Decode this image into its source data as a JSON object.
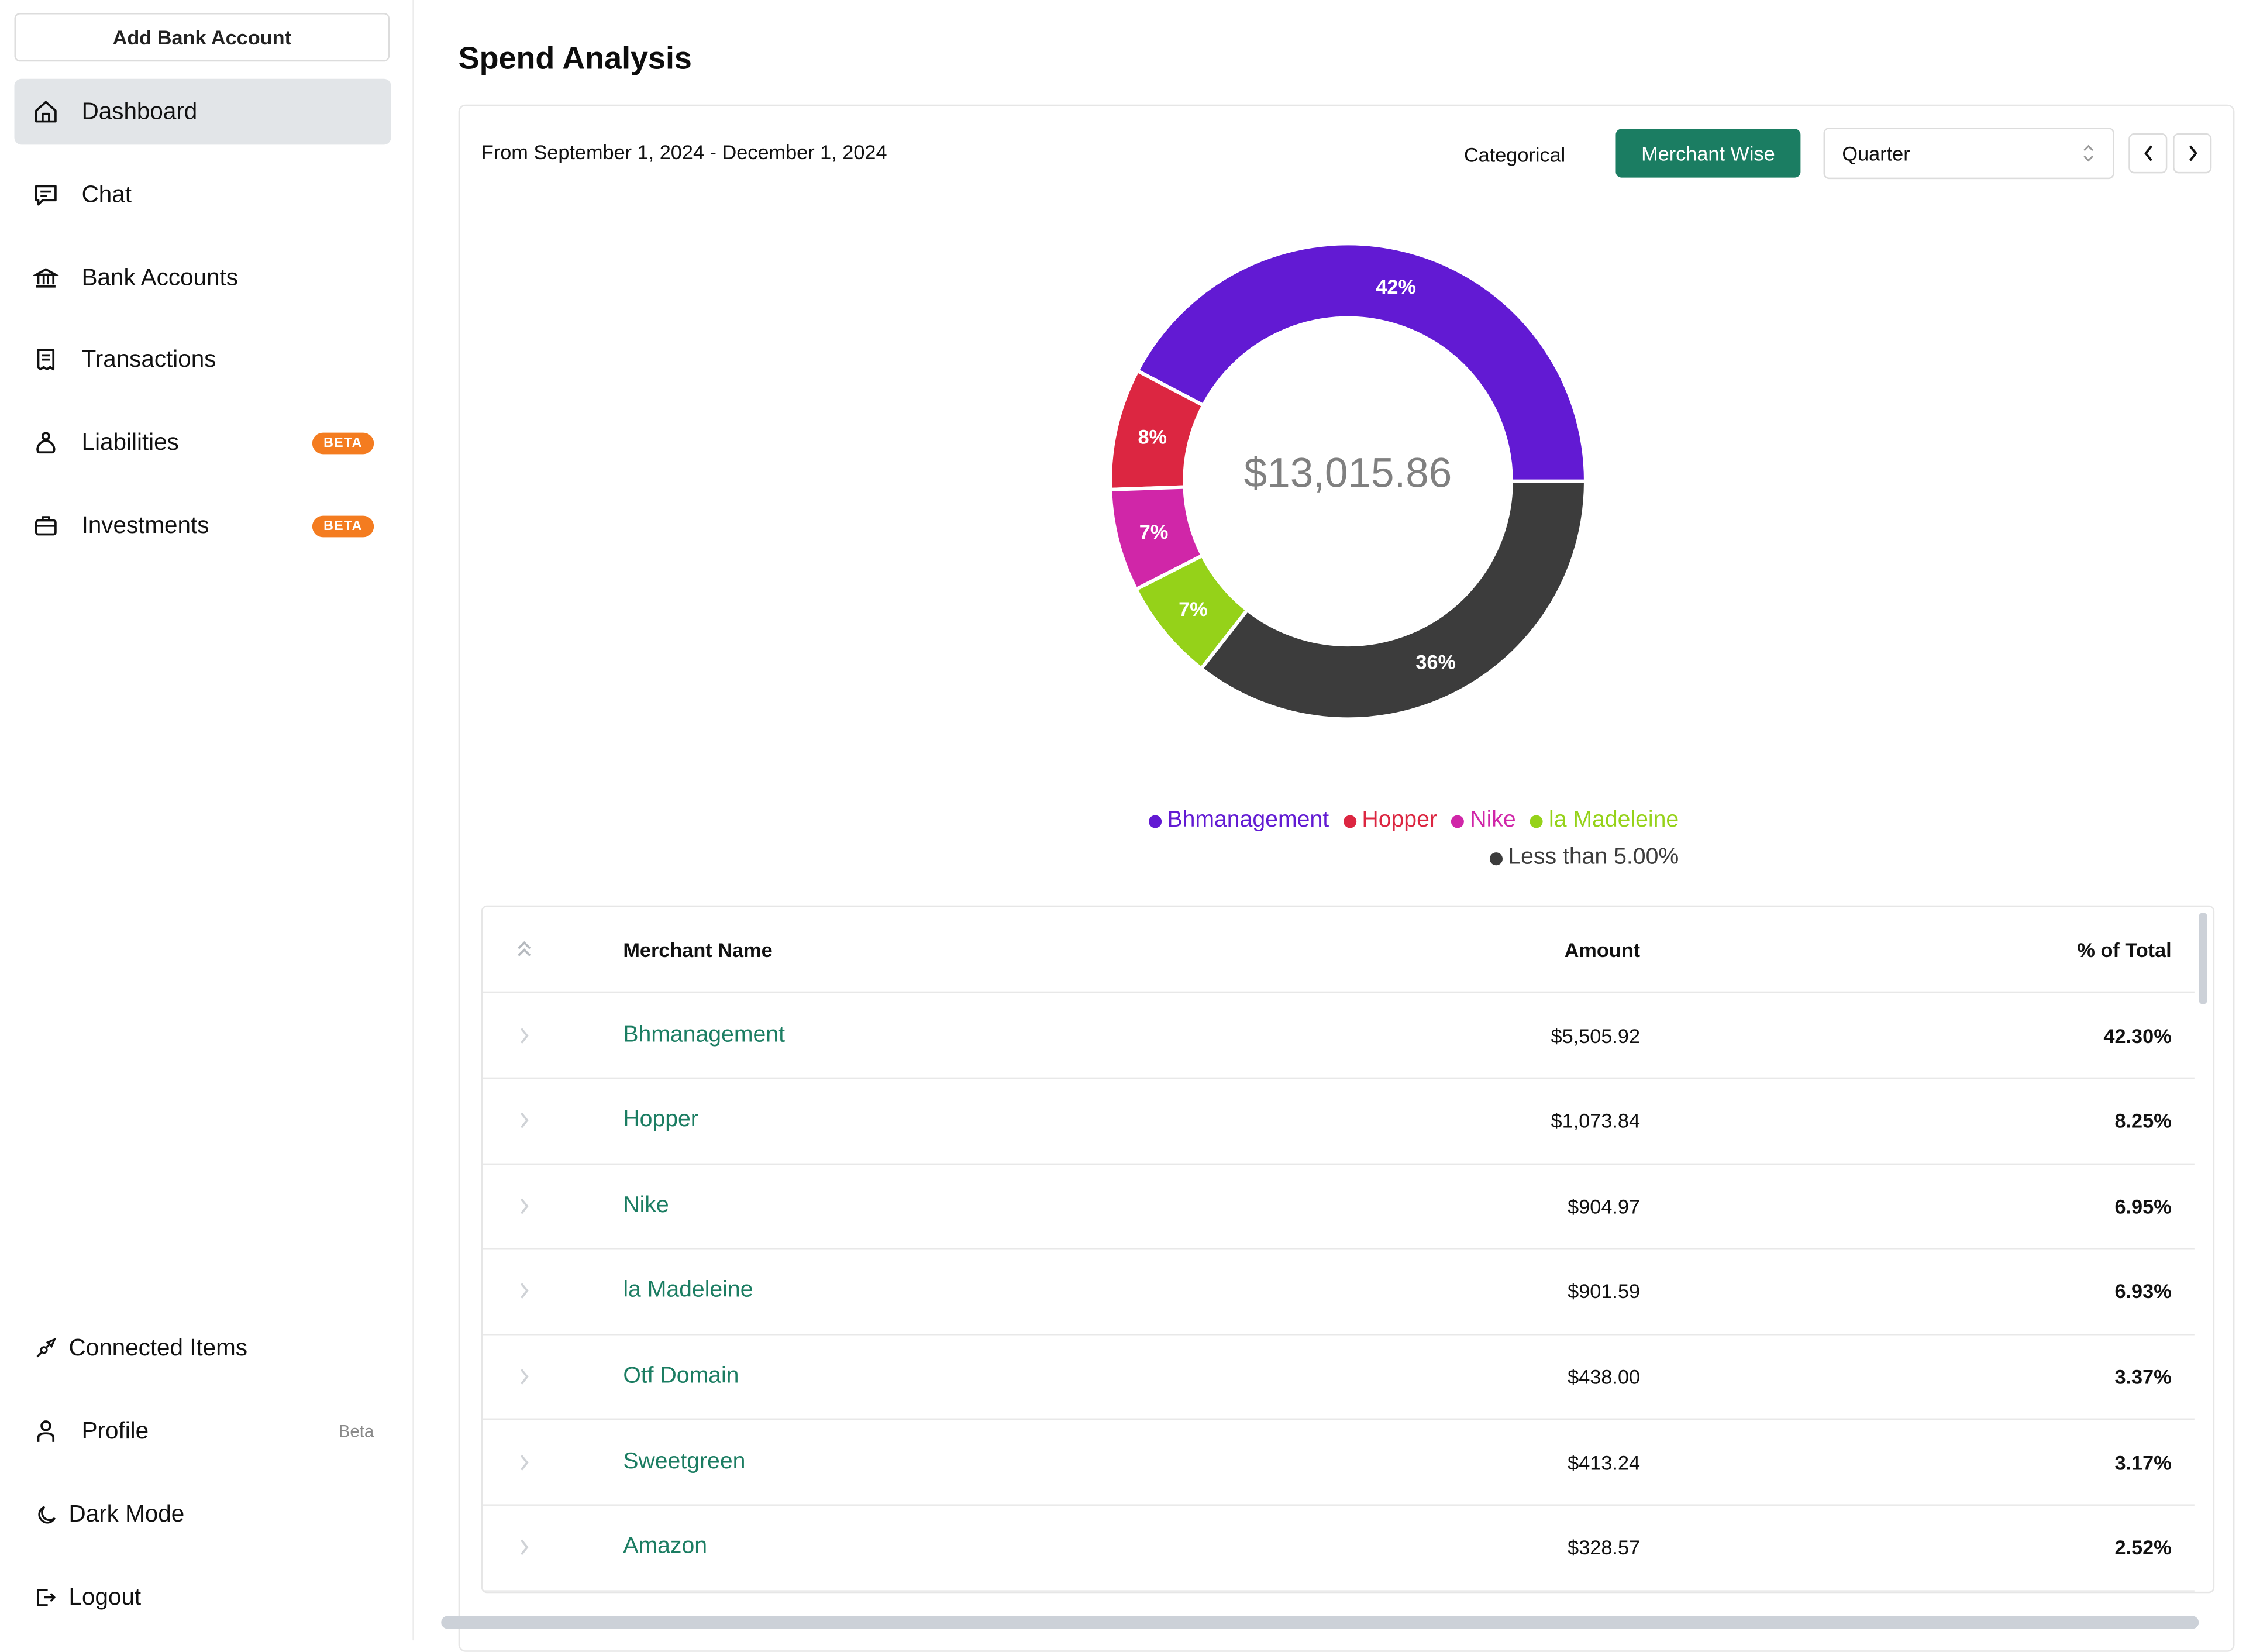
{
  "sidebar": {
    "add_bank_label": "Add Bank Account",
    "items": [
      {
        "label": "Dashboard",
        "icon": "home-icon",
        "active": true
      },
      {
        "label": "Chat",
        "icon": "chat-icon"
      },
      {
        "label": "Bank Accounts",
        "icon": "bank-icon"
      },
      {
        "label": "Transactions",
        "icon": "receipt-icon"
      },
      {
        "label": "Liabilities",
        "icon": "money-bag-icon",
        "badge": "BETA"
      },
      {
        "label": "Investments",
        "icon": "briefcase-icon",
        "badge": "BETA"
      }
    ],
    "bottom_items": [
      {
        "label": "Connected Items",
        "icon": "plug-icon"
      },
      {
        "label": "Profile",
        "icon": "user-icon",
        "tag": "Beta"
      },
      {
        "label": "Dark Mode",
        "icon": "moon-icon"
      },
      {
        "label": "Logout",
        "icon": "logout-icon"
      }
    ]
  },
  "main": {
    "title": "Spend Analysis",
    "date_range": "From September 1, 2024 - December 1, 2024",
    "toggle": {
      "categorical": "Categorical",
      "merchant_wise": "Merchant Wise",
      "active": "Merchant Wise"
    },
    "period_select": {
      "value": "Quarter"
    },
    "colors": {
      "accent": "#1b7d62"
    }
  },
  "chart_data": {
    "type": "pie",
    "variant": "donut",
    "center_label": "$13,015.86",
    "total": 13015.86,
    "start": "3-o'clock, counter-clockwise",
    "slices": [
      {
        "name": "Bhmanagement",
        "value": 42.3,
        "label": "42%",
        "color": "#621ad3"
      },
      {
        "name": "Hopper",
        "value": 8.25,
        "label": "8%",
        "color": "#dc2641"
      },
      {
        "name": "Nike",
        "value": 6.95,
        "label": "7%",
        "color": "#d026a8"
      },
      {
        "name": "la Madeleine",
        "value": 6.93,
        "label": "7%",
        "color": "#95d219"
      },
      {
        "name": "Less than 5.00%",
        "value": 35.57,
        "label": "36%",
        "color": "#3c3c3c"
      }
    ],
    "legend_placement": "bottom"
  },
  "table": {
    "headers": {
      "merchant": "Merchant Name",
      "amount": "Amount",
      "pct": "% of Total"
    },
    "rows": [
      {
        "merchant": "Bhmanagement",
        "amount": "$5,505.92",
        "pct": "42.30%"
      },
      {
        "merchant": "Hopper",
        "amount": "$1,073.84",
        "pct": "8.25%"
      },
      {
        "merchant": "Nike",
        "amount": "$904.97",
        "pct": "6.95%"
      },
      {
        "merchant": "la Madeleine",
        "amount": "$901.59",
        "pct": "6.93%"
      },
      {
        "merchant": "Otf Domain",
        "amount": "$438.00",
        "pct": "3.37%"
      },
      {
        "merchant": "Sweetgreen",
        "amount": "$413.24",
        "pct": "3.17%"
      },
      {
        "merchant": "Amazon",
        "amount": "$328.57",
        "pct": "2.52%"
      }
    ]
  }
}
